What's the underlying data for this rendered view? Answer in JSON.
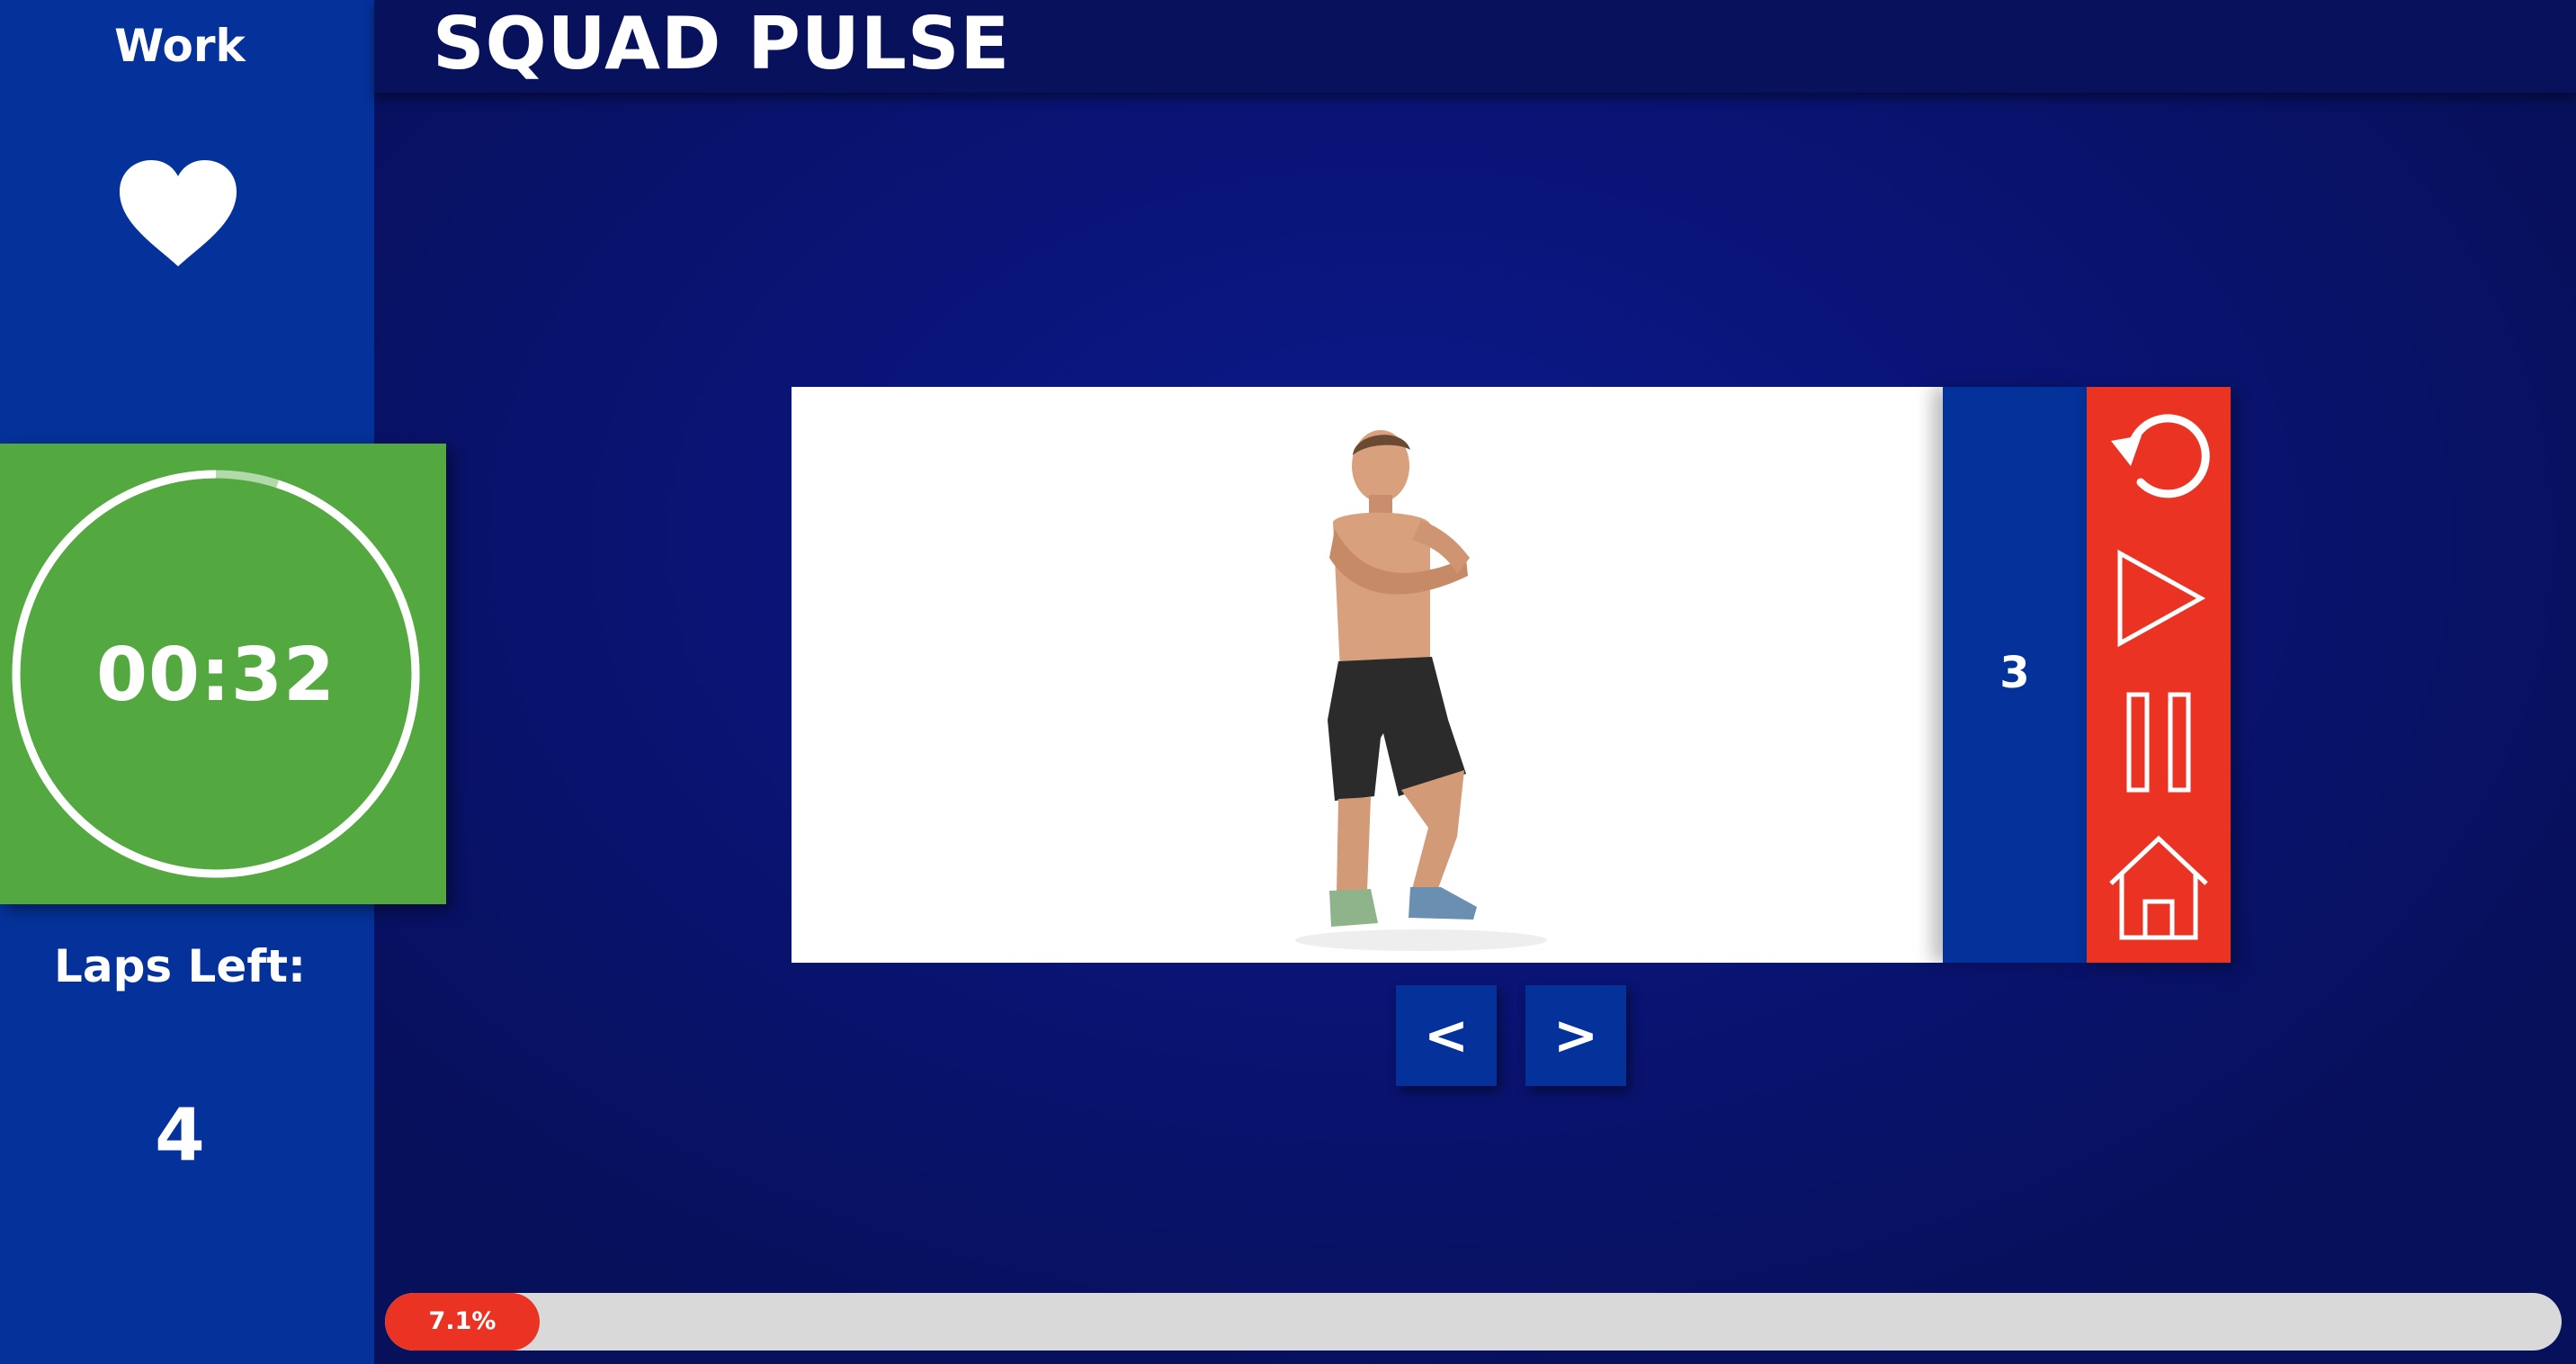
{
  "app": {
    "title": "SQUAD PULSE"
  },
  "sidebar": {
    "mode_label": "Work",
    "mode_icon": "heart-icon",
    "timer": {
      "value": "00:32",
      "ring_remaining_fraction": 0.95
    },
    "laps_label": "Laps Left:",
    "laps_value": "4"
  },
  "exercise": {
    "image_icon": "athlete-squat-figure",
    "set_number": "3"
  },
  "controls": {
    "items": [
      "restart-icon",
      "play-icon",
      "pause-icon",
      "home-icon"
    ]
  },
  "navigation": {
    "prev_label": "<",
    "next_label": ">"
  },
  "progress": {
    "percent": 7.1,
    "label": "7.1%"
  },
  "colors": {
    "sidebar_blue": "#05329a",
    "header_navy": "#08125c",
    "work_green": "#54a840",
    "control_red": "#ea3323",
    "progress_track": "#d9d9d9"
  }
}
